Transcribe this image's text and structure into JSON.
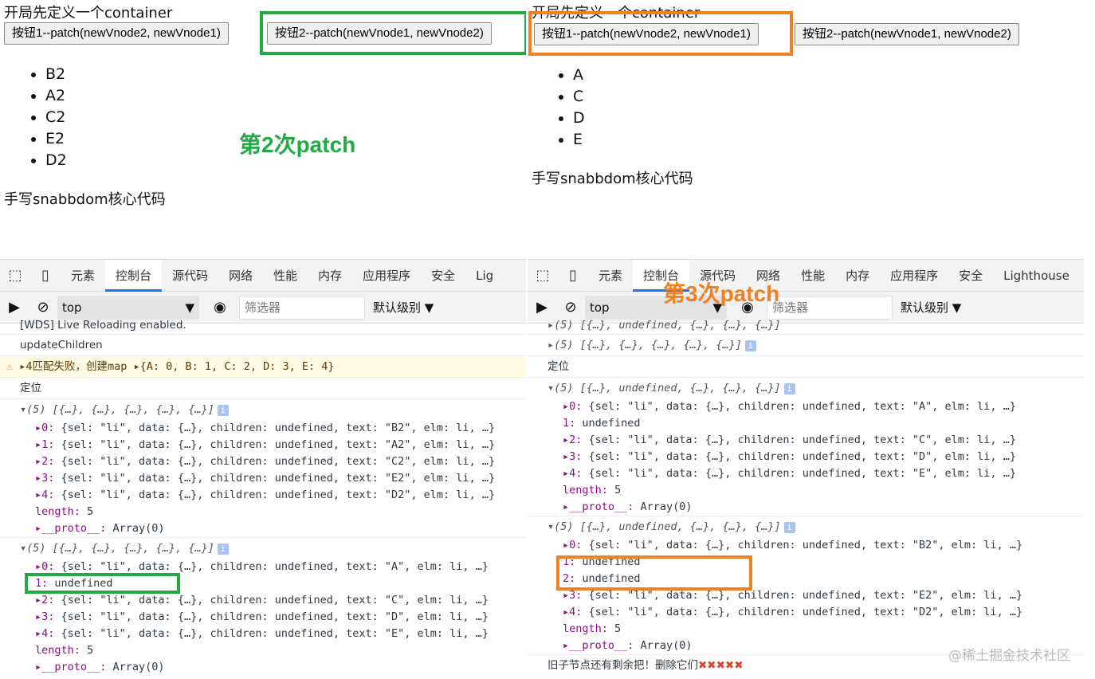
{
  "left": {
    "title": "开局先定义一个container",
    "button1": "按钮1--patch(newVnode2, newVnode1)",
    "button2": "按钮2--patch(newVnode1, newVnode2)",
    "list": [
      "B2",
      "A2",
      "C2",
      "E2",
      "D2"
    ],
    "footer": "手写snabbdom核心代码",
    "annotation": "第2次patch",
    "devtools": {
      "tabs": [
        "元素",
        "控制台",
        "源代码",
        "网络",
        "性能",
        "内存",
        "应用程序",
        "安全",
        "Lig"
      ],
      "context": "top",
      "filter_placeholder": "筛选器",
      "level": "默认级别"
    },
    "console": [
      {
        "t": "plain",
        "text": "[WDS] Live Reloading enabled."
      },
      {
        "t": "plain",
        "g": 1,
        "text": "updateChildren"
      },
      {
        "t": "warn",
        "g": 1,
        "text": "▸4匹配失败，创建map ▸{A: 0, B: 1, C: 2, D: 3, E: 4}"
      },
      {
        "t": "plain",
        "g": 1,
        "text": "定位"
      },
      {
        "t": "hdr",
        "g": 1,
        "text": "▾(5) [{…}, {…}, {…}, {…}, {…}]"
      },
      {
        "t": "item",
        "k": "▸0:",
        "text": " {sel: \"li\", data: {…}, children: undefined, text: \"B2\", elm: li, …}"
      },
      {
        "t": "item",
        "k": "▸1:",
        "text": " {sel: \"li\", data: {…}, children: undefined, text: \"A2\", elm: li, …}"
      },
      {
        "t": "item",
        "k": "▸2:",
        "text": " {sel: \"li\", data: {…}, children: undefined, text: \"C2\", elm: li, …}"
      },
      {
        "t": "item",
        "k": "▸3:",
        "text": " {sel: \"li\", data: {…}, children: undefined, text: \"E2\", elm: li, …}"
      },
      {
        "t": "item",
        "k": "▸4:",
        "text": " {sel: \"li\", data: {…}, children: undefined, text: \"D2\", elm: li, …}"
      },
      {
        "t": "item",
        "k": " length:",
        "text": " 5"
      },
      {
        "t": "item",
        "k": "▸__proto__:",
        "text": " Array(0)"
      },
      {
        "t": "hdr",
        "g": 1,
        "text": "▾(5) [{…}, {…}, {…}, {…}, {…}]"
      },
      {
        "t": "item",
        "k": "▸0:",
        "text": " {sel: \"li\", data: {…}, children: undefined, text: \"A\", elm: li, …}"
      },
      {
        "t": "item",
        "k": " 1:",
        "text": " undefined"
      },
      {
        "t": "item",
        "k": "▸2:",
        "text": " {sel: \"li\", data: {…}, children: undefined, text: \"C\", elm: li, …}"
      },
      {
        "t": "item",
        "k": "▸3:",
        "text": " {sel: \"li\", data: {…}, children: undefined, text: \"D\", elm: li, …}"
      },
      {
        "t": "item",
        "k": "▸4:",
        "text": " {sel: \"li\", data: {…}, children: undefined, text: \"E\", elm: li, …}"
      },
      {
        "t": "item",
        "k": " length:",
        "text": " 5"
      },
      {
        "t": "item",
        "k": "▸__proto__:",
        "text": " Array(0)"
      }
    ]
  },
  "right": {
    "title": "开局先定义一个container",
    "button1": "按钮1--patch(newVnode2, newVnode1)",
    "button2": "按钮2--patch(newVnode1, newVnode2)",
    "list": [
      "A",
      "C",
      "D",
      "E"
    ],
    "footer": "手写snabbdom核心代码",
    "annotation": "第3次patch",
    "devtools": {
      "tabs": [
        "元素",
        "控制台",
        "源代码",
        "网络",
        "性能",
        "内存",
        "应用程序",
        "安全",
        "Lighthouse"
      ],
      "context": "top",
      "filter_placeholder": "筛选器",
      "level": "默认级别"
    },
    "console": [
      {
        "t": "hdr",
        "text": "▸(5) [{…}, undefined, {…}, {…}, {…}]"
      },
      {
        "t": "hdr",
        "g": 1,
        "text": "▸(5) [{…}, {…}, {…}, {…}, {…}]"
      },
      {
        "t": "plain",
        "g": 1,
        "text": "定位"
      },
      {
        "t": "hdr",
        "g": 1,
        "text": "▾(5) [{…}, undefined, {…}, {…}, {…}]"
      },
      {
        "t": "item",
        "k": "▸0:",
        "text": " {sel: \"li\", data: {…}, children: undefined, text: \"A\", elm: li, …}"
      },
      {
        "t": "item",
        "k": " 1:",
        "text": " undefined"
      },
      {
        "t": "item",
        "k": "▸2:",
        "text": " {sel: \"li\", data: {…}, children: undefined, text: \"C\", elm: li, …}"
      },
      {
        "t": "item",
        "k": "▸3:",
        "text": " {sel: \"li\", data: {…}, children: undefined, text: \"D\", elm: li, …}"
      },
      {
        "t": "item",
        "k": "▸4:",
        "text": " {sel: \"li\", data: {…}, children: undefined, text: \"E\", elm: li, …}"
      },
      {
        "t": "item",
        "k": " length:",
        "text": " 5"
      },
      {
        "t": "item",
        "k": "▸__proto__:",
        "text": " Array(0)"
      },
      {
        "t": "hdr",
        "g": 1,
        "text": "▾(5) [{…}, undefined, {…}, {…}, {…}]"
      },
      {
        "t": "item",
        "k": "▸0:",
        "text": " {sel: \"li\", data: {…}, children: undefined, text: \"B2\", elm: li, …}"
      },
      {
        "t": "item",
        "k": " 1:",
        "text": " undefined"
      },
      {
        "t": "item",
        "k": " 2:",
        "text": " undefined"
      },
      {
        "t": "item",
        "k": "▸3:",
        "text": " {sel: \"li\", data: {…}, children: undefined, text: \"E2\", elm: li, …}"
      },
      {
        "t": "item",
        "k": "▸4:",
        "text": " {sel: \"li\", data: {…}, children: undefined, text: \"D2\", elm: li, …}"
      },
      {
        "t": "item",
        "k": " length:",
        "text": " 5"
      },
      {
        "t": "item",
        "k": "▸__proto__:",
        "text": " Array(0)"
      },
      {
        "t": "plain",
        "g": 1,
        "text": "旧子节点还有剩余把！删除它们",
        "x": "✖✖✖✖✖"
      }
    ]
  },
  "watermark": "@稀土掘金技术社区",
  "colors": {
    "green": "#22aa44",
    "orange": "#f08020"
  }
}
